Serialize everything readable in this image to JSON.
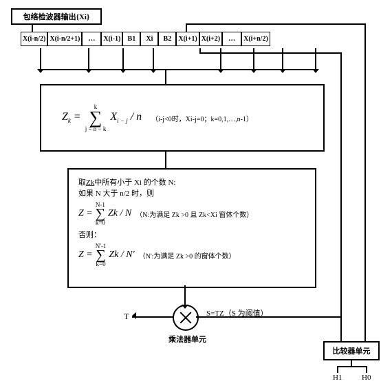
{
  "header": {
    "label": "包络检波器输出{Xi}"
  },
  "cells": {
    "c0": "X(i-n/2)",
    "c1": "X(i-n/2+1)",
    "c2": "…",
    "c3": "X(i-1)",
    "c4": "B1",
    "c5": "Xi",
    "c6": "B2",
    "c7": "X(i+1)",
    "c8": "X(i+2)",
    "c9": "…",
    "c10": "X(i+n/2)"
  },
  "formula1": {
    "lhs": "Z",
    "ksub": "k",
    "eq": " = ",
    "sigma": "∑",
    "up": "k",
    "low": "j = n − k",
    "rhs": "X",
    "isub": "i − j",
    "div": " / n",
    "cond": "（i-j<0时，Xi-j=0；k=0,1,…,n-1）"
  },
  "block2": {
    "l1a": "取",
    "l1b": "Zk",
    "l1c": "中所有小于 Xi 的个数 N:",
    "l2": "如果 N 大于 n/2 时，则",
    "f1": {
      "lhs": "Z = ",
      "sigma": "∑",
      "up": "N-1",
      "low": "k=0",
      "body": "Zk / N",
      "note": "（N:为满足 Zk >0 且 Zk<Xi 窗体个数）"
    },
    "l3": "否则：",
    "f2": {
      "lhs": "Z = ",
      "sigma": "∑",
      "up": "N'-1",
      "low": "k=0",
      "body": "Zk / N'",
      "note": "（N':为满足 Zk >0 的窗体个数）"
    }
  },
  "mult": {
    "T": "T",
    "S": "S=TZ（S 为阈值）",
    "label": "乘法器单元"
  },
  "comp": {
    "label": "比较器单元",
    "h1": "H1",
    "h0": "H0"
  }
}
